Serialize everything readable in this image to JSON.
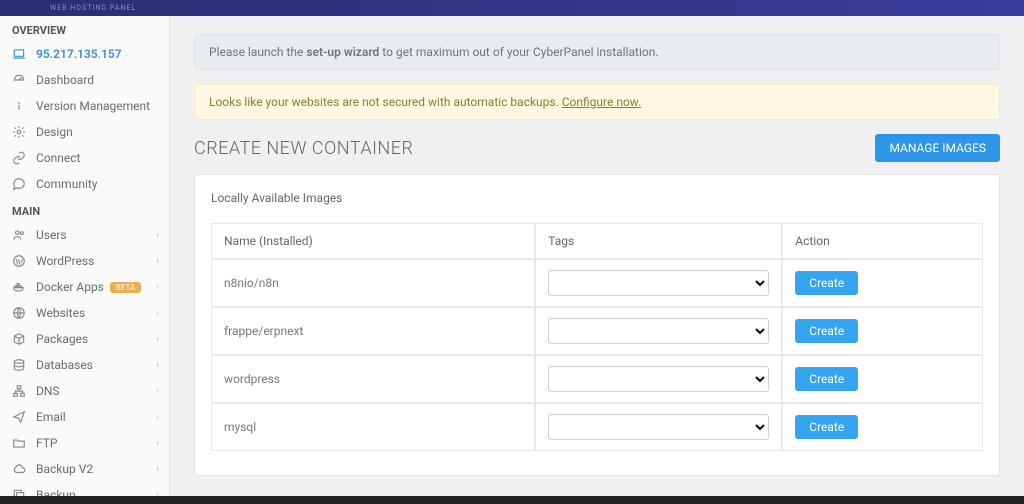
{
  "topbar": {
    "brand": "WEB HOSTING PANEL"
  },
  "sidebar": {
    "section_overview": "OVERVIEW",
    "ip": "95.217.135.157",
    "dashboard": "Dashboard",
    "version_mgmt": "Version Management",
    "design": "Design",
    "connect": "Connect",
    "community": "Community",
    "section_main": "MAIN",
    "users": "Users",
    "wordpress": "WordPress",
    "docker_apps": "Docker Apps",
    "docker_badge": "BETA",
    "websites": "Websites",
    "packages": "Packages",
    "databases": "Databases",
    "dns": "DNS",
    "email": "Email",
    "ftp": "FTP",
    "backupv2": "Backup V2",
    "backup": "Backup"
  },
  "alerts": {
    "setup_pre": "Please launch the ",
    "setup_bold": "set-up wizard",
    "setup_post": " to get maximum out of your CyberPanel installation.",
    "backup_pre": "Looks like your websites are not secured with automatic backups. ",
    "backup_link": "Configure now."
  },
  "page": {
    "title": "CREATE NEW CONTAINER",
    "manage_btn": "MANAGE IMAGES",
    "card_subtitle": "Locally Available Images",
    "th_name": "Name (Installed)",
    "th_tags": "Tags",
    "th_action": "Action",
    "create_label": "Create",
    "images": [
      {
        "name": "n8nio/n8n"
      },
      {
        "name": "frappe/erpnext"
      },
      {
        "name": "wordpress"
      },
      {
        "name": "mysql"
      }
    ]
  }
}
